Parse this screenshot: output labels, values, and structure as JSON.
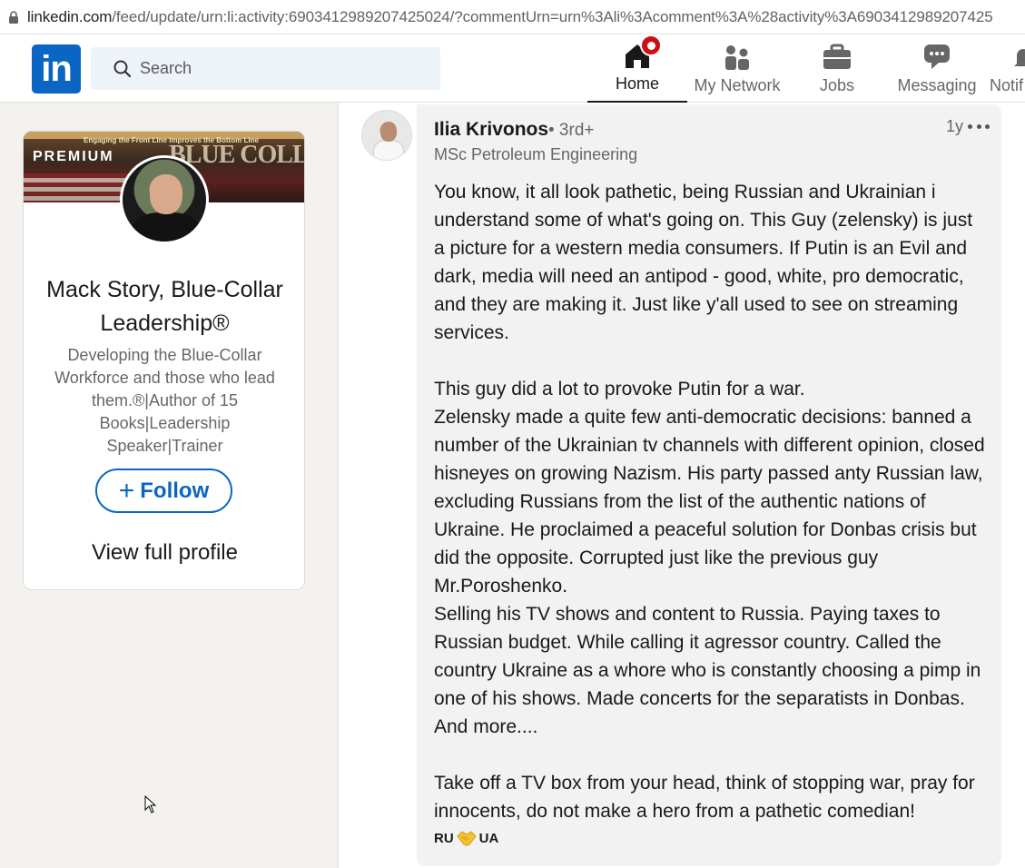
{
  "browser": {
    "url_host": "linkedin.com",
    "url_path": "/feed/update/urn:li:activity:6903412989207425024/?commentUrn=urn%3Ali%3Acomment%3A%28activity%3A6903412989207425"
  },
  "nav": {
    "logo": "in",
    "search_placeholder": "Search",
    "items": [
      {
        "label": "Home",
        "icon": "home-icon"
      },
      {
        "label": "My Network",
        "icon": "network-icon"
      },
      {
        "label": "Jobs",
        "icon": "briefcase-icon"
      },
      {
        "label": "Messaging",
        "icon": "message-icon"
      },
      {
        "label": "Notif",
        "icon": "bell-icon"
      }
    ]
  },
  "profile": {
    "banner_tag": "Engaging the Front Line Improves the Bottom Line",
    "banner_text": "BLUE COLLAR LEADERSHIP.COM",
    "premium": "PREMIUM",
    "name": "Mack Story, Blue-Collar Leadership®",
    "headline": "Developing the Blue-Collar Workforce and those who lead them.®|Author of 15 Books|Leadership Speaker|Trainer",
    "follow_label": "Follow",
    "view_profile": "View full profile"
  },
  "comment": {
    "author": "Ilia Krivonos",
    "degree": "• 3rd+",
    "author_title": "MSc Petroleum Engineering",
    "time": "1y",
    "text": "You know, it all look pathetic, being Russian and Ukrainian i understand some of what's going on. This Guy (zelensky) is just a picture for a western media consumers. If Putin is an Evil and dark, media will need an antipod - good, white, pro democratic, and they are making it. Just like y'all used to see on streaming services.\n\nThis guy did a lot to provoke Putin for a war.\nZelensky made a quite few anti-democratic decisions: banned a number of the Ukrainian tv channels with different opinion, closed hisneyes on growing Nazism. His party passed anty Russian law, excluding Russians from the list of the authentic nations of Ukraine. He proclaimed a peaceful solution for Donbas crisis but did the opposite. Corrupted just like the previous guy Mr.Poroshenko.\nSelling his TV shows and content to Russia. Paying taxes to Russian budget. While calling it agressor country. Called the country Ukraine as a whore who is constantly choosing a pimp in one of his shows. Made concerts for the separatists in Donbas. And more....\n\nTake off a TV box from your head, think of stopping war, pray for innocents, do not make a hero from a pathetic comedian!",
    "footer_left": "RU",
    "footer_right": "UA"
  },
  "colors": {
    "brand": "#0a66c2",
    "badge": "#cc1016",
    "bubble": "#f2f2f2"
  }
}
